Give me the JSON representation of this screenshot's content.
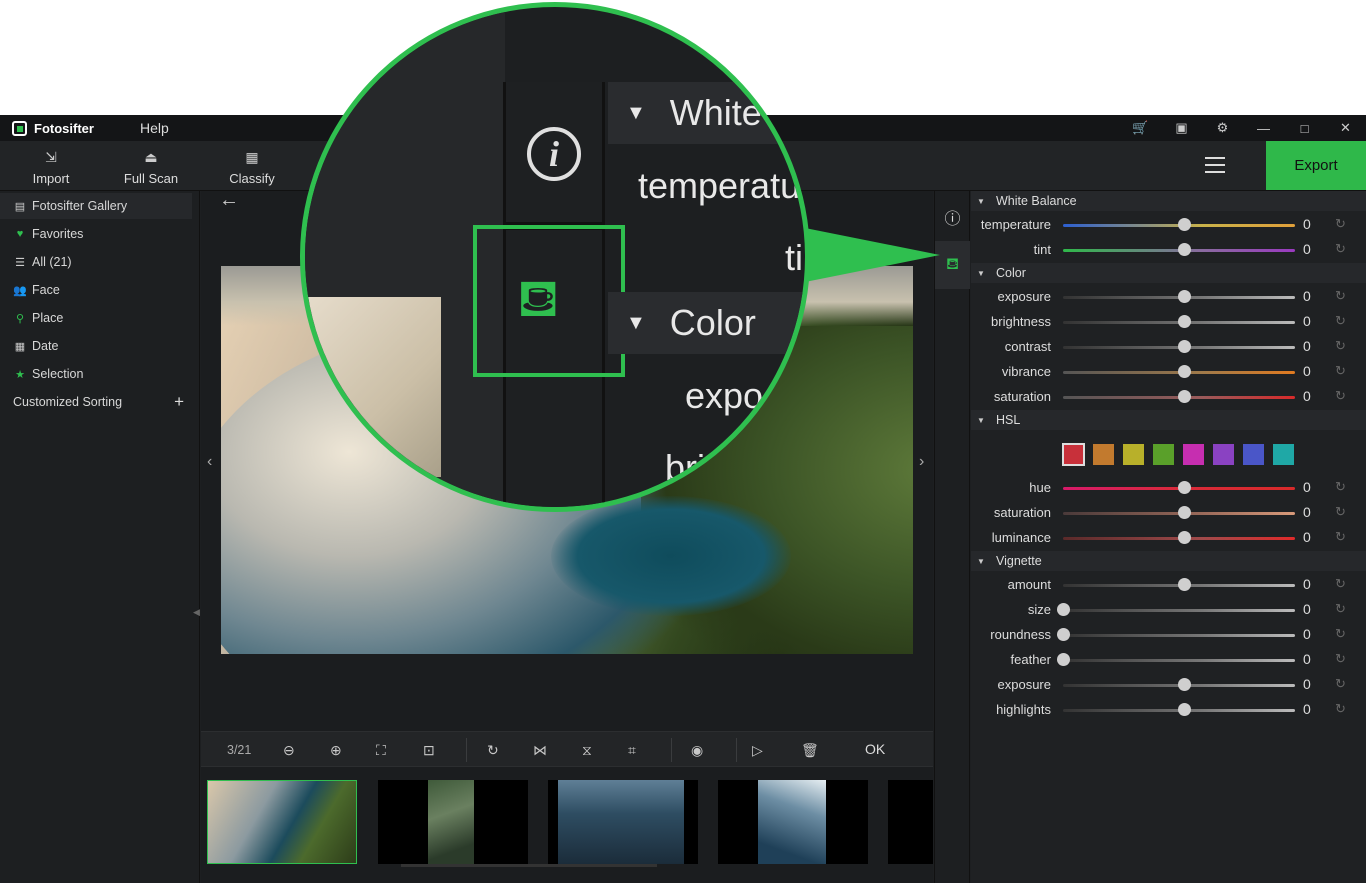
{
  "app": {
    "name": "Fotosifter",
    "menu_help": "Help"
  },
  "titlebar_icons": [
    "cart-icon",
    "save-icon",
    "gear-icon",
    "minimize-icon",
    "maximize-icon",
    "close-icon"
  ],
  "toolbar": {
    "import": "Import",
    "full_scan": "Full Scan",
    "classify": "Classify",
    "export": "Export"
  },
  "sidebar": {
    "items": [
      {
        "label": "Fotosifter Gallery",
        "icon": "gallery-icon"
      },
      {
        "label": "Favorites",
        "icon": "favorites-icon"
      },
      {
        "label": "All (21)",
        "icon": "list-icon"
      },
      {
        "label": "Face",
        "icon": "face-icon"
      },
      {
        "label": "Place",
        "icon": "place-icon"
      },
      {
        "label": "Date",
        "icon": "calendar-icon"
      },
      {
        "label": "Selection",
        "icon": "selection-icon"
      }
    ],
    "custom_sorting": "Customized Sorting"
  },
  "viewer": {
    "page": "3/21",
    "ok": "OK"
  },
  "panel": {
    "white_balance": {
      "title": "White Balance",
      "rows": [
        {
          "label": "temperature",
          "value": "0",
          "level": 0.52
        },
        {
          "label": "tint",
          "value": "0",
          "level": 0.52
        }
      ]
    },
    "color": {
      "title": "Color",
      "rows": [
        {
          "label": "exposure",
          "value": "0",
          "level": 0.52
        },
        {
          "label": "brightness",
          "value": "0",
          "level": 0.52
        },
        {
          "label": "contrast",
          "value": "0",
          "level": 0.52
        },
        {
          "label": "vibrance",
          "value": "0",
          "level": 0.52
        },
        {
          "label": "saturation",
          "value": "0",
          "level": 0.52
        }
      ]
    },
    "hsl": {
      "title": "HSL",
      "swatches": [
        "#c8303a",
        "#c27a2e",
        "#b8b02a",
        "#5aa02a",
        "#c62eb0",
        "#8a42c2",
        "#4a56c8",
        "#1fa8a6"
      ],
      "rows": [
        {
          "label": "hue",
          "value": "0",
          "level": 0.52
        },
        {
          "label": "saturation",
          "value": "0",
          "level": 0.52
        },
        {
          "label": "luminance",
          "value": "0",
          "level": 0.52
        }
      ]
    },
    "vignette": {
      "title": "Vignette",
      "rows": [
        {
          "label": "amount",
          "value": "0",
          "level": 0.52
        },
        {
          "label": "size",
          "value": "0",
          "level": 0.0
        },
        {
          "label": "roundness",
          "value": "0",
          "level": 0.0
        },
        {
          "label": "feather",
          "value": "0",
          "level": 0.0
        },
        {
          "label": "exposure",
          "value": "0",
          "level": 0.52
        },
        {
          "label": "highlights",
          "value": "0",
          "level": 0.52
        }
      ]
    }
  },
  "callout": {
    "white": "White",
    "temperature": "temperatu",
    "tint": "ti",
    "color": "Color",
    "exposure": "expo",
    "brightness": "bri"
  },
  "colors": {
    "accent": "#2fbf4f"
  }
}
